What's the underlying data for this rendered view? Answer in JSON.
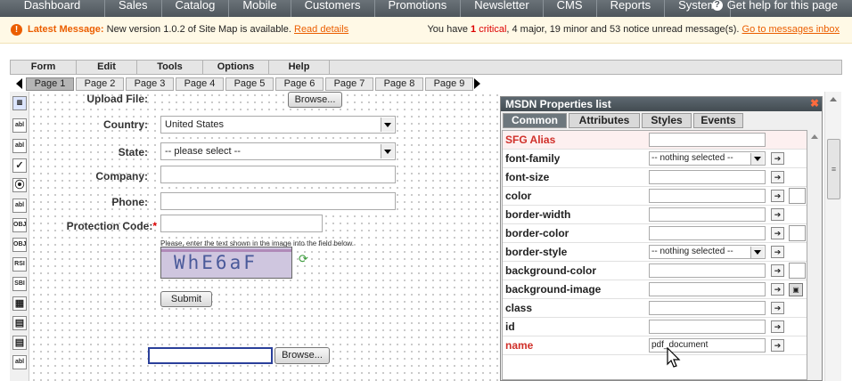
{
  "nav": {
    "items": [
      "Dashboard",
      "Sales",
      "Catalog",
      "Mobile",
      "Customers",
      "Promotions",
      "Newsletter",
      "CMS",
      "Reports",
      "System"
    ],
    "help": "Get help for this page"
  },
  "message": {
    "label": "Latest Message:",
    "text": "New version 1.0.2 of Site Map is available.",
    "link": "Read details",
    "right_pre": "You have",
    "critical_count": "1",
    "critical_word": "critical",
    "rest": ", 4 major, 19 minor and 53 notice unread message(s).",
    "right_link": "Go to messages inbox"
  },
  "menu": [
    "Form",
    "Edit",
    "Tools",
    "Options",
    "Help"
  ],
  "pages": [
    "Page 1",
    "Page 2",
    "Page 3",
    "Page 4",
    "Page 5",
    "Page 6",
    "Page 7",
    "Page 8",
    "Page 9"
  ],
  "form": {
    "upload_label": "Upload File:",
    "browse": "Browse...",
    "country_label": "Country:",
    "country_value": "United States",
    "state_label": "State:",
    "state_value": "-- please select --",
    "company_label": "Company:",
    "phone_label": "Phone:",
    "protection_label": "Protection Code:",
    "required_mark": "*",
    "captcha_hint": "Please, enter the text shown in the image into the field below.",
    "captcha_text": "WhE6aF",
    "submit": "Submit",
    "browse2": "Browse..."
  },
  "tools": [
    "abl",
    "abl",
    "✓",
    "⦿",
    "abl",
    "OBJ",
    "OBJ",
    "RSI",
    "SBI",
    "▦",
    "▤",
    "▤",
    "abl"
  ],
  "panel": {
    "title": "MSDN Properties list",
    "tabs": [
      "Common",
      "Attributes",
      "Styles",
      "Events"
    ],
    "rows": [
      {
        "name": "SFG Alias",
        "value": "",
        "highlight": true
      },
      {
        "name": "font-family",
        "value": "-- nothing selected --"
      },
      {
        "name": "font-size",
        "value": ""
      },
      {
        "name": "color",
        "value": ""
      },
      {
        "name": "border-width",
        "value": ""
      },
      {
        "name": "border-color",
        "value": ""
      },
      {
        "name": "border-style",
        "value": "-- nothing selected --"
      },
      {
        "name": "background-color",
        "value": ""
      },
      {
        "name": "background-image",
        "value": ""
      },
      {
        "name": "class",
        "value": ""
      },
      {
        "name": "id",
        "value": ""
      },
      {
        "name": "name",
        "value": "pdf_document",
        "highlight": true
      }
    ]
  },
  "colors": {
    "nav_bg": "#55606a",
    "accent": "#eb5e00",
    "critical": "#dd0000",
    "active_tab": "#6d777d"
  }
}
